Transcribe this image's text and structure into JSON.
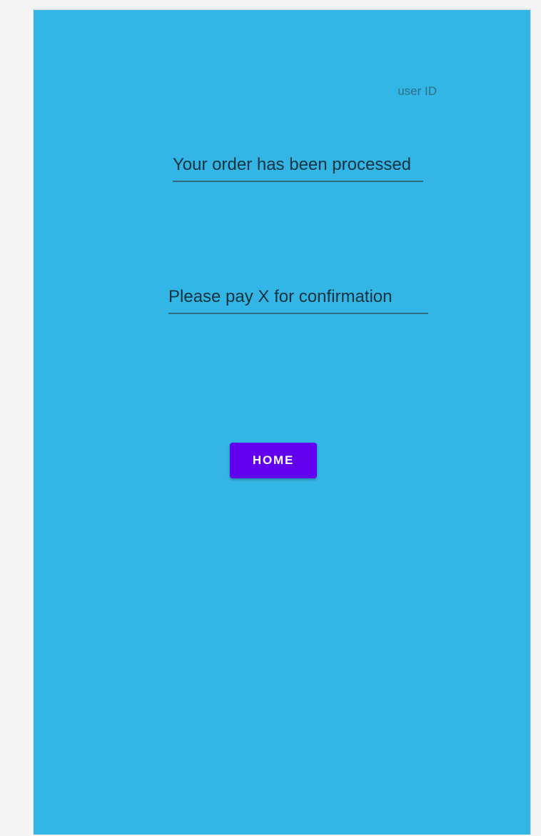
{
  "screen": {
    "background_color": "#33b5e5",
    "user_id_label": "user ID",
    "order_status_text": "Your order has been processed",
    "payment_prompt_text": "Please pay X for confirmation",
    "home_button": {
      "label": "HOME",
      "color": "#6200ee",
      "text_color": "#ffffff"
    }
  }
}
